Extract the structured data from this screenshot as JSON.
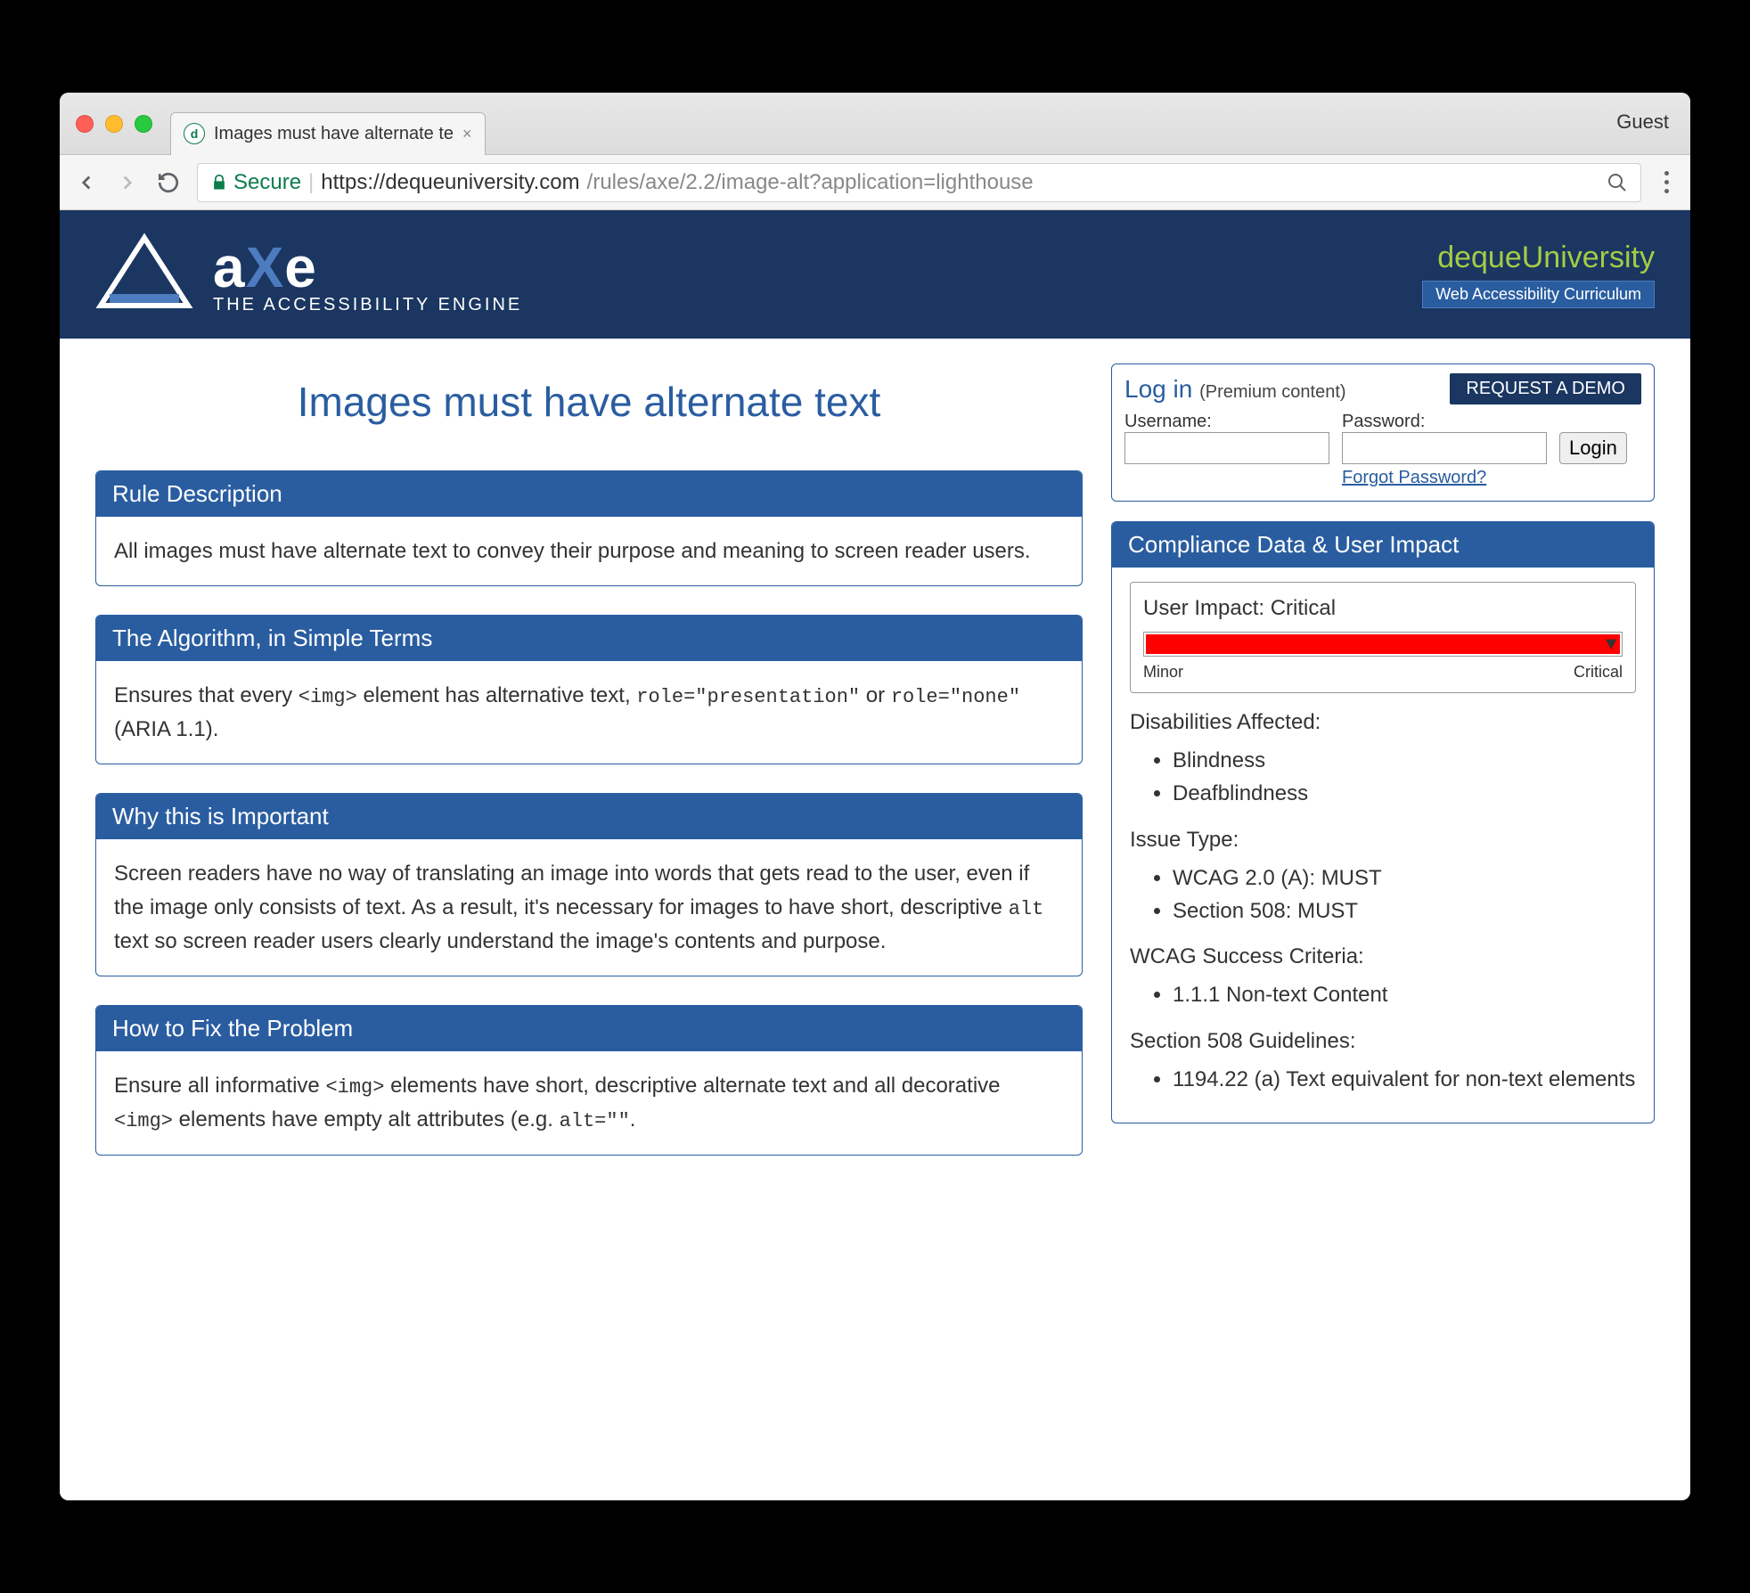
{
  "browser": {
    "tab_title": "Images must have alternate te",
    "guest": "Guest",
    "secure": "Secure",
    "url_host": "https://dequeuniversity.com",
    "url_path": "/rules/axe/2.2/image-alt?application=lighthouse"
  },
  "logo": {
    "name": "axe",
    "tagline": "THE ACCESSIBILITY ENGINE"
  },
  "brand": {
    "deque": "deque",
    "university": "University",
    "subtitle": "Web Accessibility Curriculum"
  },
  "page_title": "Images must have alternate text",
  "panels": {
    "rule": {
      "title": "Rule Description",
      "body": "All images must have alternate text to convey their purpose and meaning to screen reader users."
    },
    "algorithm": {
      "title": "The Algorithm, in Simple Terms",
      "body_pre": "Ensures that every ",
      "code1": "<img>",
      "body_mid": " element has alternative text, ",
      "code2": "role=\"presentation\"",
      "body_mid2": " or ",
      "code3": "role=\"none\"",
      "body_end": " (ARIA 1.1)."
    },
    "why": {
      "title": "Why this is Important",
      "body_pre": "Screen readers have no way of translating an image into words that gets read to the user, even if the image only consists of text. As a result, it's necessary for images to have short, descriptive ",
      "code1": "alt",
      "body_end": " text so screen reader users clearly understand the image's contents and purpose."
    },
    "fix": {
      "title": "How to Fix the Problem",
      "body_pre": "Ensure all informative ",
      "code1": "<img>",
      "body_mid": " elements have short, descriptive alternate text and all decorative ",
      "code2": "<img>",
      "body_mid2": " elements have empty alt attributes (e.g. ",
      "code3": "alt=\"\"",
      "body_end": "."
    }
  },
  "login": {
    "title": "Log in",
    "subtitle": "(Premium content)",
    "demo": "REQUEST A DEMO",
    "username_label": "Username:",
    "password_label": "Password:",
    "button": "Login",
    "forgot": "Forgot Password?"
  },
  "compliance": {
    "title": "Compliance Data & User Impact",
    "user_impact_label": "User Impact:",
    "user_impact_value": "Critical",
    "scale_min": "Minor",
    "scale_max": "Critical",
    "disabilities_label": "Disabilities Affected:",
    "disabilities": [
      "Blindness",
      "Deafblindness"
    ],
    "issue_type_label": "Issue Type:",
    "issue_types": [
      "WCAG 2.0 (A): MUST",
      "Section 508: MUST"
    ],
    "wcag_label": "WCAG Success Criteria:",
    "wcag": [
      "1.1.1 Non-text Content"
    ],
    "s508_label": "Section 508 Guidelines:",
    "s508": [
      "1194.22 (a) Text equivalent for non-text elements"
    ]
  }
}
